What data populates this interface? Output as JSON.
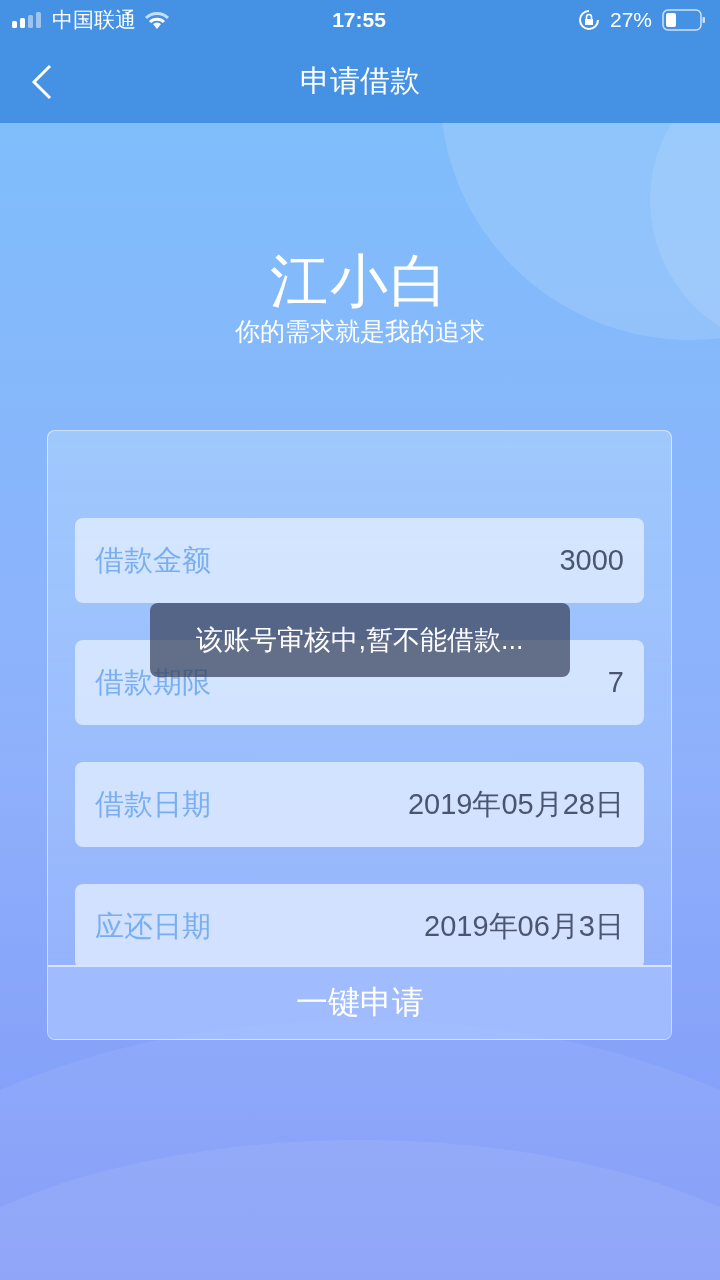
{
  "status_bar": {
    "carrier": "中国联通",
    "time": "17:55",
    "battery": "27%"
  },
  "nav": {
    "title": "申请借款"
  },
  "brand": {
    "name": "江小白",
    "slogan": "你的需求就是我的追求"
  },
  "fields": [
    {
      "label": "借款金额",
      "value": "3000"
    },
    {
      "label": "借款期限",
      "value": "7"
    },
    {
      "label": "借款日期",
      "value": "2019年05月28日"
    },
    {
      "label": "应还日期",
      "value": "2019年06月3日"
    }
  ],
  "submit_button": "一键申请",
  "toast": "该账号审核中,暂不能借款..."
}
